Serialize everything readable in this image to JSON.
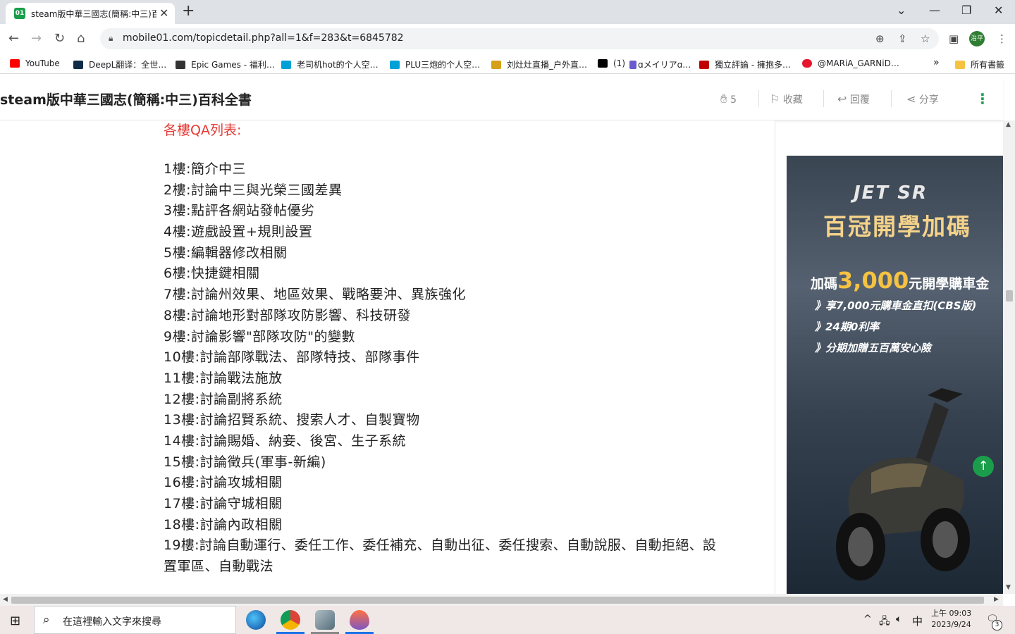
{
  "browser": {
    "tab_title": "steam版中華三國志(簡稱:中三)百",
    "tab_favicon": "01",
    "url": "mobile01.com/topicdetail.php?all=1&f=283&t=6845782",
    "profile_label": "治平",
    "bookmarks": [
      {
        "label": "YouTube",
        "color": "#ff0000"
      },
      {
        "label": "DeepL翻译：全世…",
        "color": "#0f2b46"
      },
      {
        "label": "Epic Games - 福利…",
        "color": "#333333"
      },
      {
        "label": "老司机hot的个人空…",
        "color": "#00a1d6"
      },
      {
        "label": "PLU三炮的个人空…",
        "color": "#00a1d6"
      },
      {
        "label": "刘灶灶直播_户外直…",
        "color": "#d4a017"
      },
      {
        "label": "(1)",
        "color": "#000000"
      },
      {
        "label": "ɑメイリアɑ…",
        "color": "#6a5acd"
      },
      {
        "label": "獨立評論 - 擁抱多…",
        "color": "#c00000"
      },
      {
        "label": "@MARiA_GARNiD…",
        "color": "#e6162d"
      }
    ],
    "bookmarks_more": "»",
    "all_bookmarks": "所有書籤"
  },
  "site": {
    "title": "steam版中華三國志(簡稱:中三)百科全書",
    "like_count": "5",
    "favorite_label": "收藏",
    "reply_label": "回覆",
    "share_label": "分享"
  },
  "post": {
    "heading": "各樓QA列表:",
    "items": [
      "1樓:簡介中三",
      "2樓:討論中三與光榮三國差異",
      "3樓:點評各網站發帖優劣",
      "4樓:遊戲設置+規則設置",
      "5樓:編輯器修改相關",
      "6樓:快捷鍵相關",
      "7樓:討論州效果、地區效果、戰略要沖、異族強化",
      "8樓:討論地形對部隊攻防影響、科技研發",
      "9樓:討論影響\"部隊攻防\"的變數",
      "10樓:討論部隊戰法、部隊特技、部隊事件",
      "11樓:討論戰法施放",
      "12樓:討論副將系統",
      "13樓:討論招賢系統、搜索人才、自製寶物",
      "14樓:討論賜婚、納妾、後宮、生子系統",
      "15樓:討論徵兵(軍事-新編)",
      "16樓:討論攻城相關",
      "17樓:討論守城相關",
      "18樓:討論內政相關",
      "19樓:討論自動運行、委任工作、委任補充、自動出征、委任搜索、自動說服、自動拒絕、設",
      "置軍區、自動戰法"
    ]
  },
  "ad": {
    "logo": "JET SR",
    "headline": "百冠開學加碼",
    "line1_prefix": "加碼",
    "line1_amount": "3,000",
    "line1_suffix": "元開學購車金",
    "bullets": [
      "》享7,000元購車金直扣(CBS版)",
      "》24期0利率",
      "》分期加贈五百萬安心險"
    ]
  },
  "taskbar": {
    "search_placeholder": "在這裡輸入文字來搜尋",
    "ime": "中",
    "time": "上午 09:03",
    "date": "2023/9/24",
    "notifications": "3"
  }
}
